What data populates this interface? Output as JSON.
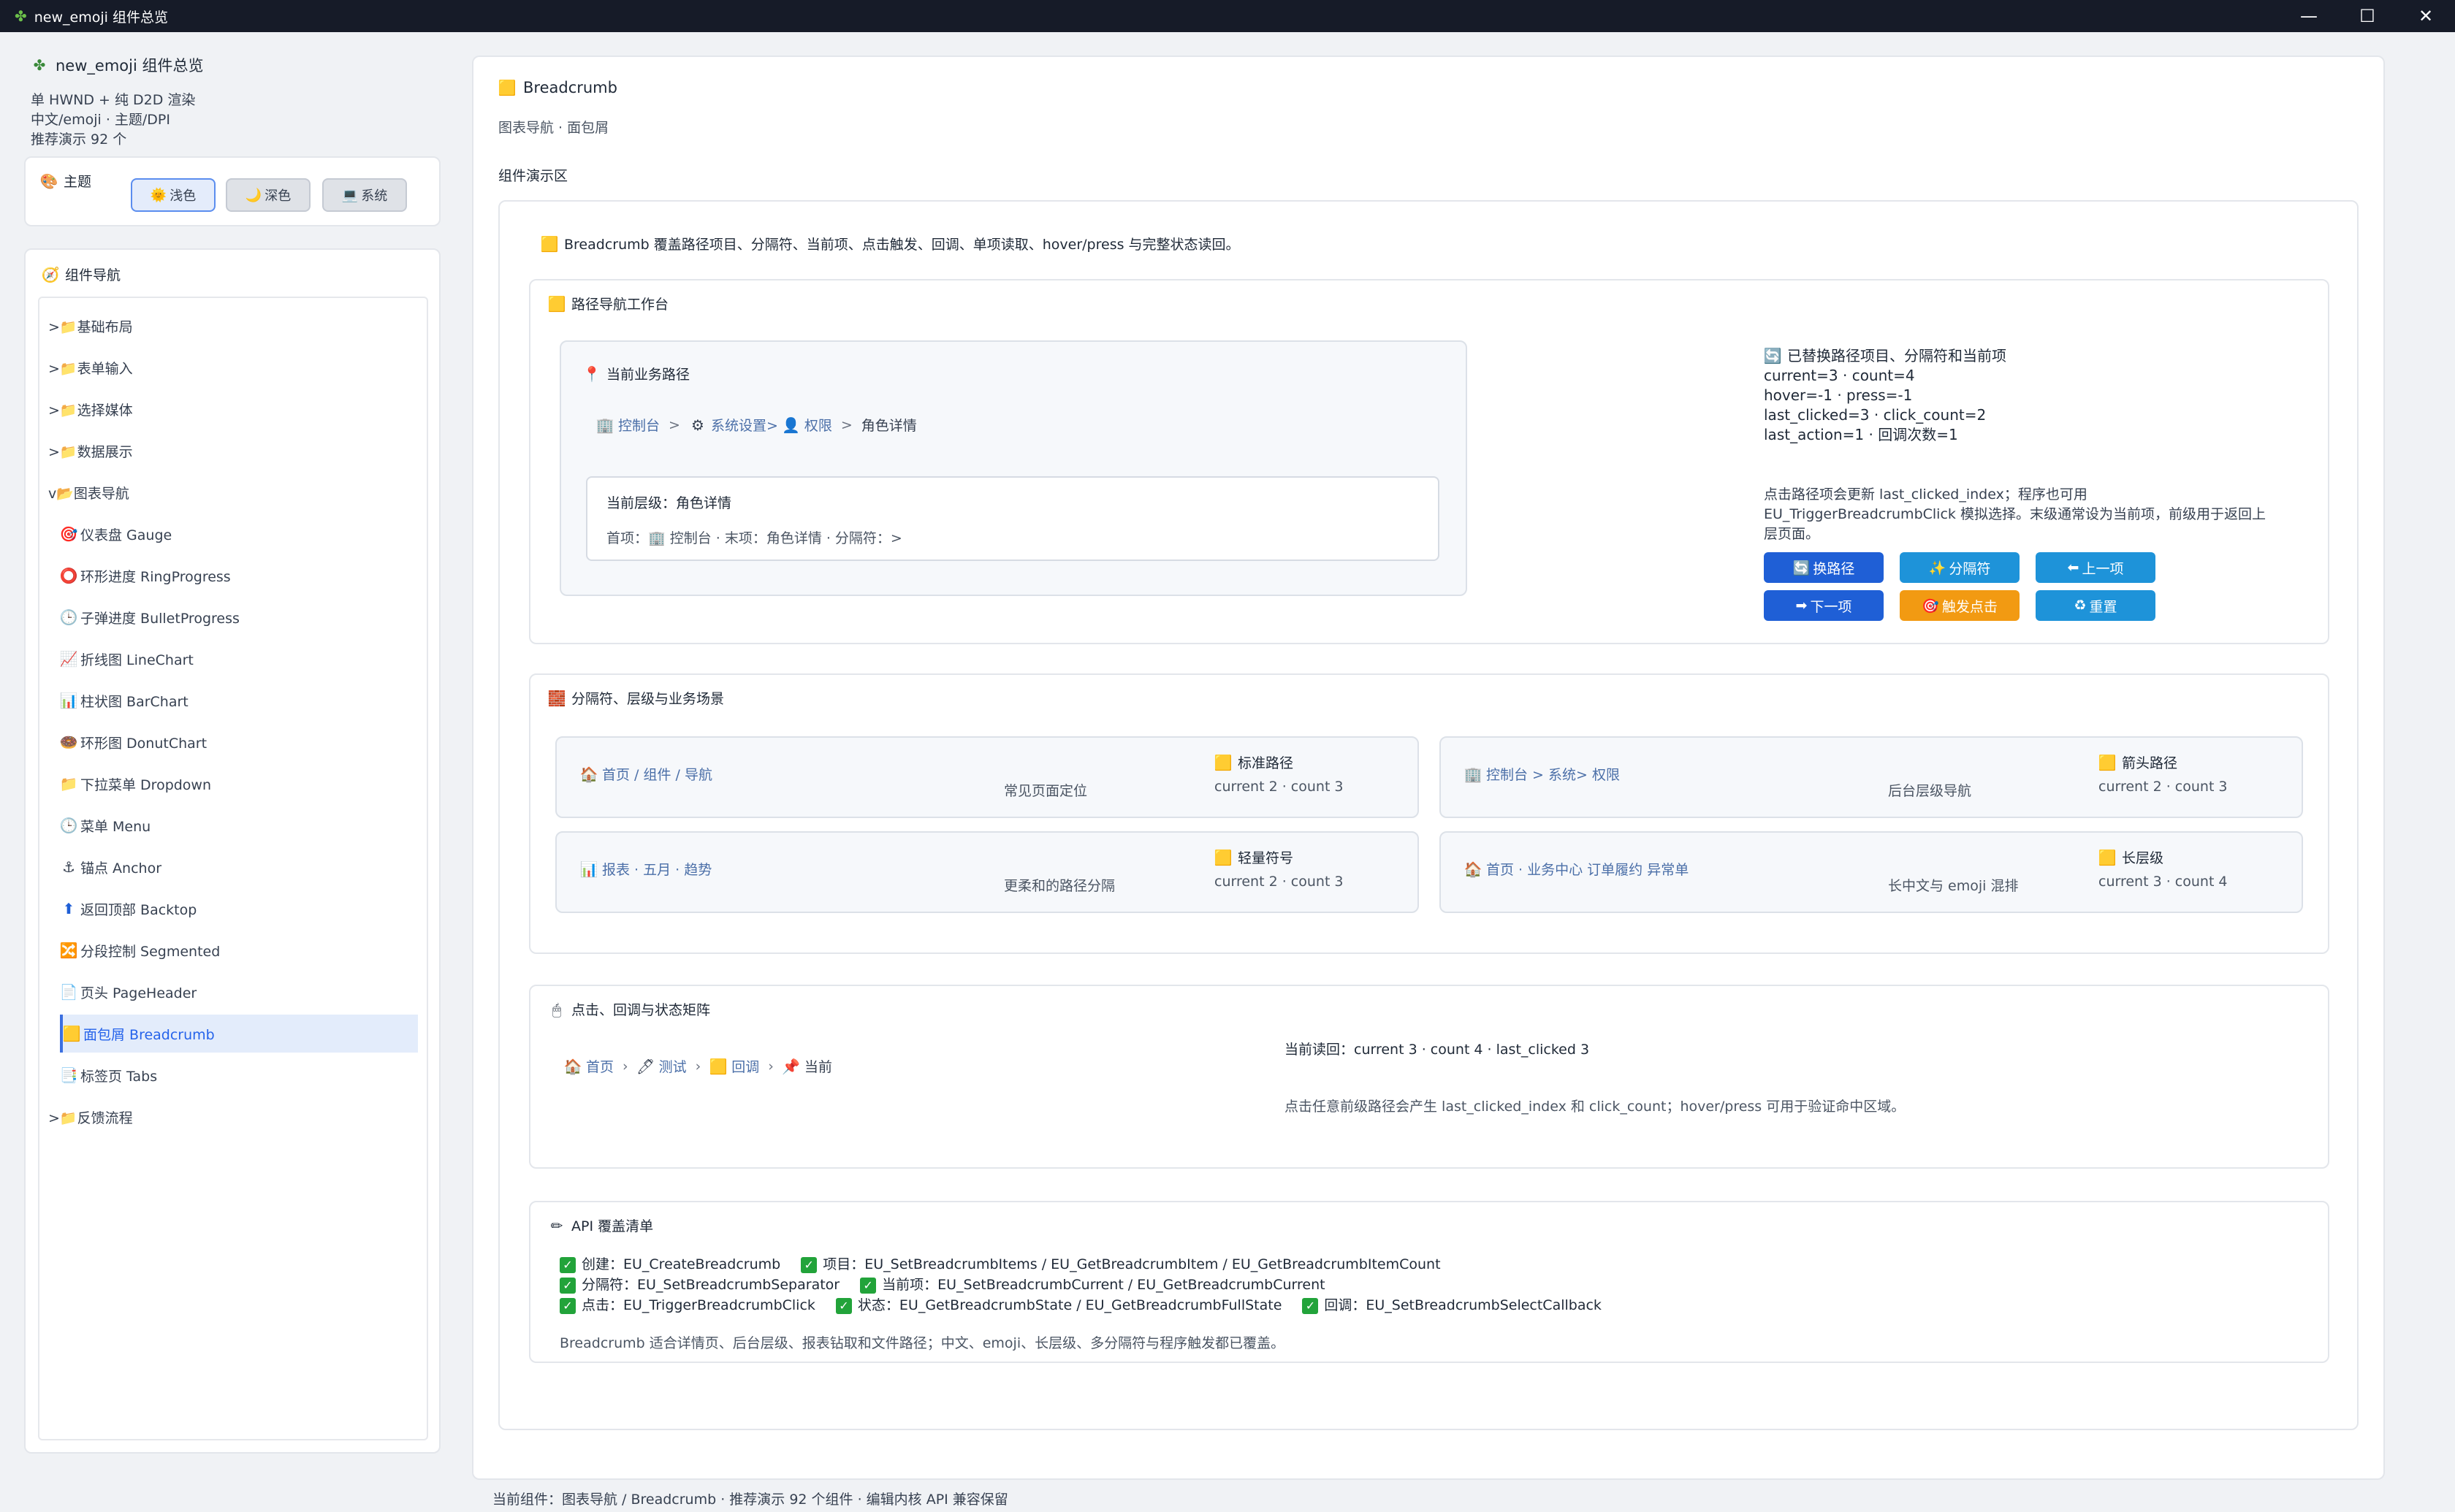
{
  "window": {
    "title": "new_emoji 组件总览",
    "min": "—",
    "max": "☐",
    "close": "✕"
  },
  "sidebar": {
    "app_title": "new_emoji 组件总览",
    "meta": [
      "单 HWND + 纯 D2D 渲染",
      "中文/emoji · 主题/DPI",
      "推荐演示 92 个"
    ],
    "theme": {
      "label": "主题",
      "light": "浅色",
      "dark": "深色",
      "system": "系统"
    },
    "nav_title": "组件导航",
    "items": [
      {
        "label": ">📁基础布局"
      },
      {
        "label": ">📁表单输入"
      },
      {
        "label": ">📁选择媒体"
      },
      {
        "label": ">📁数据展示"
      },
      {
        "label": "v📂图表导航"
      },
      {
        "label": "仪表盘 Gauge",
        "icon": "🎯"
      },
      {
        "label": "环形进度 RingProgress",
        "icon": "⭕"
      },
      {
        "label": "子弹进度 BulletProgress",
        "icon": "🕒"
      },
      {
        "label": "折线图 LineChart",
        "icon": "📈"
      },
      {
        "label": "柱状图 BarChart",
        "icon": "📊"
      },
      {
        "label": "环形图 DonutChart",
        "icon": "🍩"
      },
      {
        "label": "下拉菜单 Dropdown",
        "icon": "📁"
      },
      {
        "label": "菜单 Menu",
        "icon": "🕒"
      },
      {
        "label": "锚点 Anchor",
        "icon": "⚓"
      },
      {
        "label": "返回顶部 Backtop",
        "icon": "⬆"
      },
      {
        "label": "分段控制 Segmented",
        "icon": "🔀"
      },
      {
        "label": "页头 PageHeader",
        "icon": "📄"
      },
      {
        "label": "面包屑 Breadcrumb",
        "icon": "🟨"
      },
      {
        "label": "标签页 Tabs",
        "icon": "📑"
      },
      {
        "label": ">📁反馈流程"
      }
    ]
  },
  "main": {
    "title": "Breadcrumb",
    "subtitle": "图表导航 · 面包屑",
    "demo_label": "组件演示区",
    "intro": "Breadcrumb 覆盖路径项目、分隔符、当前项、点击触发、回调、单项读取、hover/press 与完整状态读回。",
    "workbench": {
      "title": "路径导航工作台",
      "panel_title": "当前业务路径",
      "crumbs": [
        "控制台",
        ">",
        "系统设置>",
        "权限",
        ">",
        "角色详情"
      ],
      "level_title": "当前层级：角色详情",
      "level_detail": "首项：🏢 控制台 · 末项：角色详情 · 分隔符：>",
      "status_head": "已替换路径项目、分隔符和当前项",
      "status_lines": [
        "current=3 · count=4",
        "hover=-1 · press=-1",
        "last_clicked=3 · click_count=2",
        "last_action=1 · 回调次数=1"
      ],
      "hint": [
        "点击路径项会更新 last_clicked_index；程序也可用",
        "EU_TriggerBreadcrumbClick 模拟选择。末级通常设为当前项，前级用于返回上",
        "层页面。"
      ],
      "buttons": [
        "换路径",
        "分隔符",
        "上一项",
        "下一项",
        "触发点击",
        "重置"
      ]
    },
    "scenes": {
      "title": "分隔符、层级与业务场景",
      "cards": [
        {
          "crumbs": "首页   / 组件 / 导航",
          "desc": "常见页面定位",
          "tag": "标准路径",
          "count": "current 2 · count 3"
        },
        {
          "crumbs": "控制台 > 系统> 权限",
          "desc": "后台层级导航",
          "tag": "箭头路径",
          "count": "current 2 · count 3"
        },
        {
          "crumbs": "报表  · 五月 · 趋势",
          "desc": "更柔和的路径分隔",
          "tag": "轻量符号",
          "count": "current 2 · count 3"
        },
        {
          "crumbs": "首页   · 业务中心  订单履约  异常单",
          "desc": "长中文与 emoji 混排",
          "tag": "长层级",
          "count": "current 3 · count 4"
        }
      ]
    },
    "matrix": {
      "title": "点击、回调与状态矩阵",
      "crumbs": [
        "首页",
        "测试",
        "回调",
        "当前"
      ],
      "readback": "当前读回：current 3 · count 4 · last_clicked 3",
      "note": "点击任意前级路径会产生 last_clicked_index 和 click_count；hover/press 可用于验证命中区域。"
    },
    "api": {
      "title": "API 覆盖清单",
      "line1": [
        "创建：EU_CreateBreadcrumb",
        "项目：EU_SetBreadcrumbItems / EU_GetBreadcrumbItem / EU_GetBreadcrumbItemCount"
      ],
      "line2": [
        "分隔符：EU_SetBreadcrumbSeparator",
        "当前项：EU_SetBreadcrumbCurrent / EU_GetBreadcrumbCurrent"
      ],
      "line3": [
        "点击：EU_TriggerBreadcrumbClick",
        "状态：EU_GetBreadcrumbState / EU_GetBreadcrumbFullState",
        "回调：EU_SetBreadcrumbSelectCallback"
      ],
      "summary": "Breadcrumb 适合详情页、后台层级、报表钻取和文件路径；中文、emoji、长层级、多分隔符与程序触发都已覆盖。"
    }
  },
  "footer": "当前组件：图表导航 / Breadcrumb · 推荐演示 92 个组件 · 编辑内核 API 兼容保留"
}
